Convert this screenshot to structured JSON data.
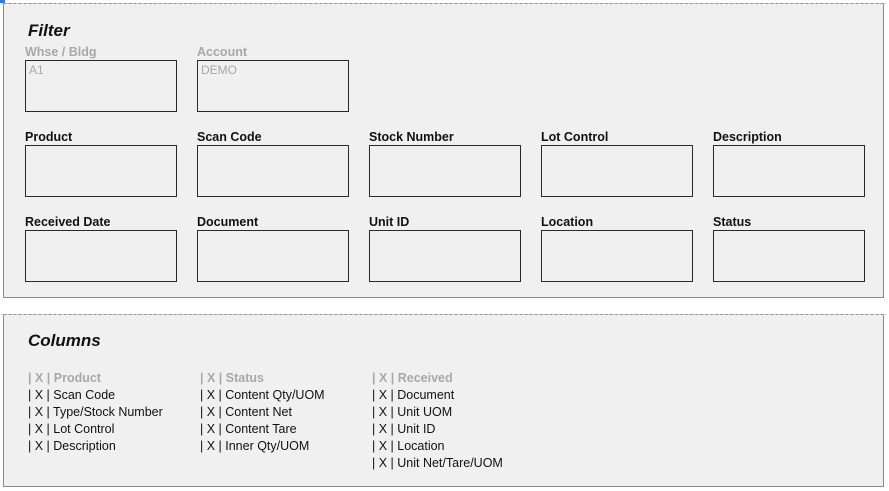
{
  "filter": {
    "title": "Filter",
    "fields": [
      {
        "label": "Whse / Bldg",
        "value": "A1",
        "muted": true
      },
      {
        "label": "Account",
        "value": "DEMO",
        "muted": true
      },
      {
        "label": "Product",
        "value": ""
      },
      {
        "label": "Scan Code",
        "value": ""
      },
      {
        "label": "Stock Number",
        "value": ""
      },
      {
        "label": "Lot Control",
        "value": ""
      },
      {
        "label": "Description",
        "value": ""
      },
      {
        "label": "Received Date",
        "value": ""
      },
      {
        "label": "Document",
        "value": ""
      },
      {
        "label": "Unit ID",
        "value": ""
      },
      {
        "label": "Location",
        "value": ""
      },
      {
        "label": "Status",
        "value": ""
      }
    ]
  },
  "columns": {
    "title": "Columns",
    "groups": [
      {
        "header": "| X | Product",
        "items": [
          "| X | Scan Code",
          "| X | Type/Stock Number",
          "| X | Lot Control",
          "| X | Description"
        ]
      },
      {
        "header": "| X | Status",
        "items": [
          "| X | Content Qty/UOM",
          "| X | Content Net",
          "| X | Content Tare",
          "| X | Inner Qty/UOM"
        ]
      },
      {
        "header": "| X | Received",
        "items": [
          "| X | Document",
          "| X | Unit UOM",
          "| X | Unit ID",
          "| X | Location",
          "| X | Unit Net/Tare/UOM"
        ]
      }
    ]
  }
}
